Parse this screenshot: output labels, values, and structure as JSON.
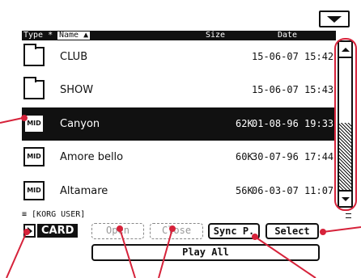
{
  "header": {
    "type_label": "Type *",
    "name_label": "Name ▲",
    "size_label": "Size",
    "date_label": "Date"
  },
  "files": [
    {
      "name": "CLUB",
      "size": "",
      "date": "15-06-07 15:42",
      "kind": "folder-icon",
      "selected": false
    },
    {
      "name": "SHOW",
      "size": "",
      "date": "15-06-07 15:43",
      "kind": "folder-icon",
      "selected": false
    },
    {
      "name": "Canyon",
      "size": "62K",
      "date": "01-08-96 19:33",
      "kind": "midi-file-icon",
      "selected": true
    },
    {
      "name": "Amore bello",
      "size": "60K",
      "date": "30-07-96 17:44",
      "kind": "midi-file-icon",
      "selected": false
    },
    {
      "name": "Altamare",
      "size": "56K",
      "date": "06-03-07 11:07",
      "kind": "midi-file-icon",
      "selected": false
    }
  ],
  "midi_icon_text": "MID",
  "path": "≡ [KORG USER]",
  "device": {
    "label": "CARD"
  },
  "buttons": {
    "open": "Open",
    "close": "Close",
    "sync": "Sync P.",
    "select": "Select",
    "play_all": "Play All"
  },
  "colors": {
    "foreground": "#111111",
    "background": "#ffffff",
    "callout": "#d6223a"
  }
}
